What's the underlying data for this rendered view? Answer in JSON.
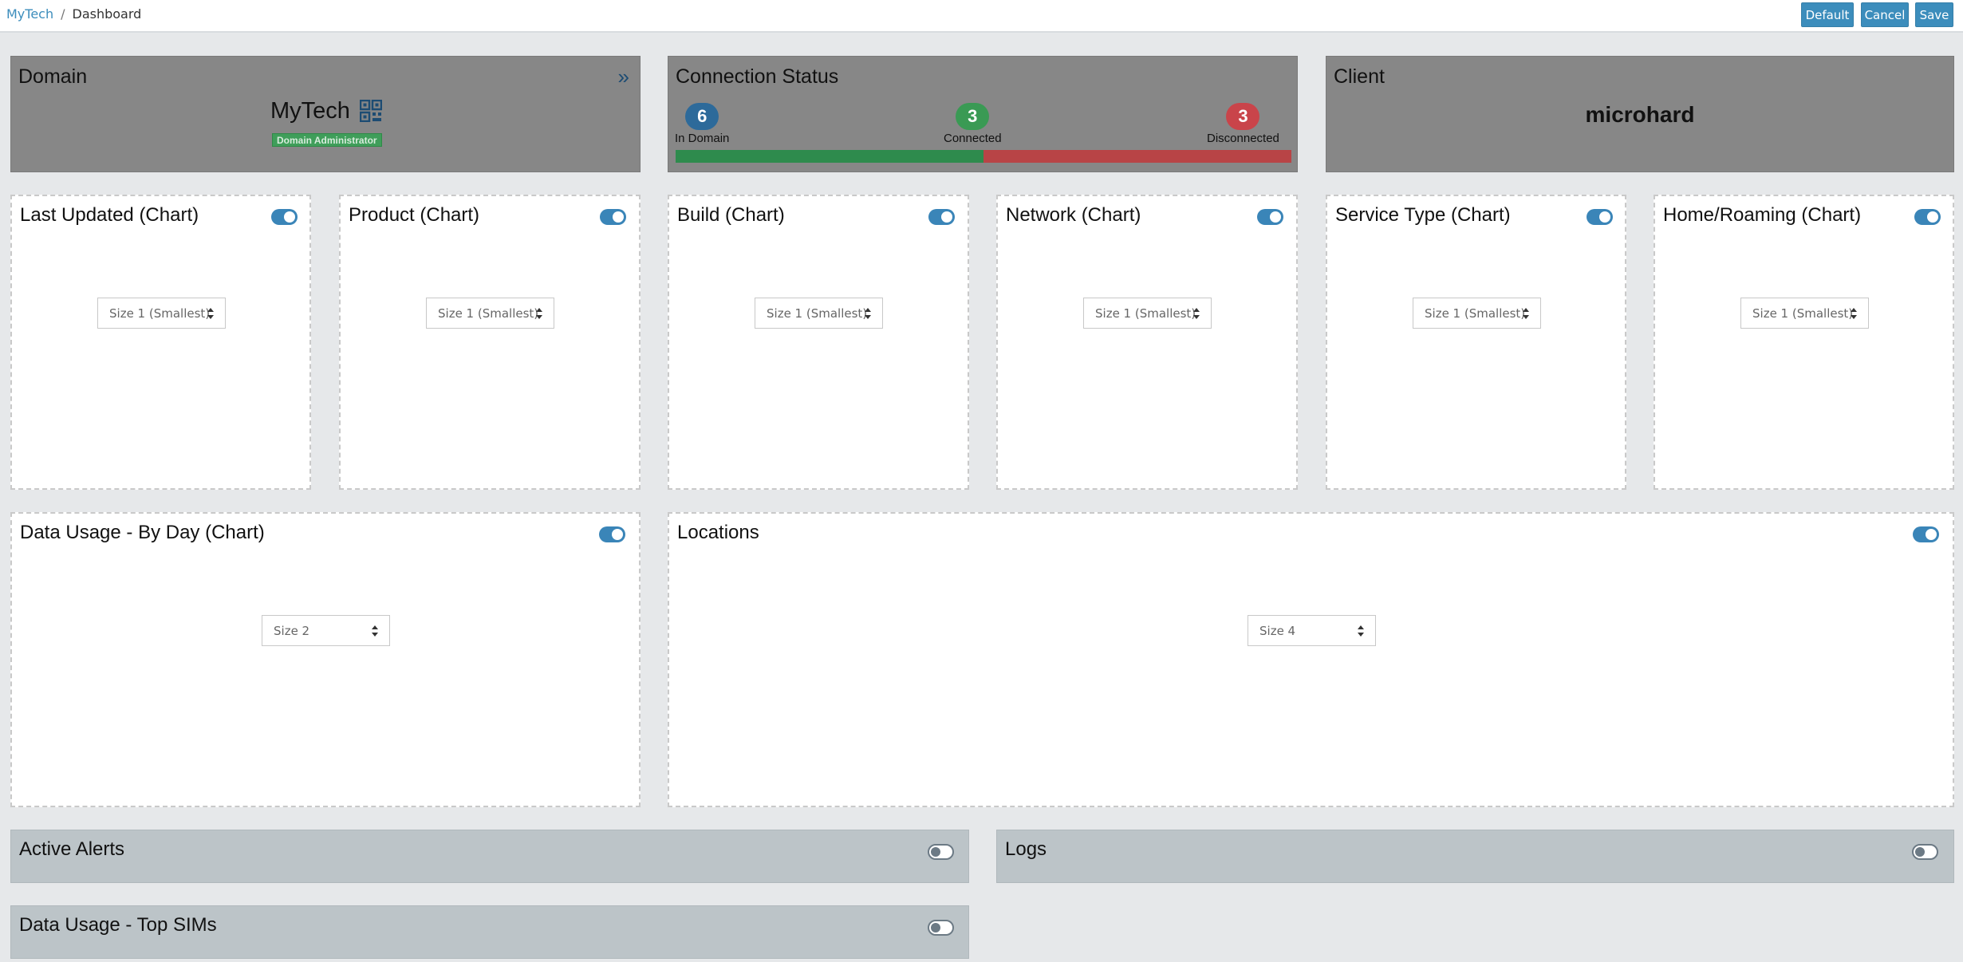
{
  "breadcrumb": {
    "home": "MyTech",
    "current": "Dashboard"
  },
  "toolbar": {
    "default_label": "Default",
    "cancel_label": "Cancel",
    "save_label": "Save"
  },
  "domain": {
    "title": "Domain",
    "name": "MyTech",
    "role": "Domain Administrator",
    "expand_icon": "»"
  },
  "connection_status": {
    "title": "Connection Status",
    "in_domain": {
      "count": "6",
      "label": "In Domain"
    },
    "connected": {
      "count": "3",
      "label": "Connected"
    },
    "disconnected": {
      "count": "3",
      "label": "Disconnected"
    },
    "connected_fraction": 0.5
  },
  "client": {
    "title": "Client",
    "name": "microhard"
  },
  "charts": [
    {
      "title": "Last Updated (Chart)",
      "size": "Size 1 (Smallest)",
      "enabled": true
    },
    {
      "title": "Product (Chart)",
      "size": "Size 1 (Smallest)",
      "enabled": true
    },
    {
      "title": "Build (Chart)",
      "size": "Size 1 (Smallest)",
      "enabled": true
    },
    {
      "title": "Network (Chart)",
      "size": "Size 1 (Smallest)",
      "enabled": true
    },
    {
      "title": "Service Type (Chart)",
      "size": "Size 1 (Smallest)",
      "enabled": true
    },
    {
      "title": "Home/Roaming (Chart)",
      "size": "Size 1 (Smallest)",
      "enabled": true
    }
  ],
  "data_usage_by_day": {
    "title": "Data Usage - By Day (Chart)",
    "size": "Size 2",
    "enabled": true
  },
  "locations": {
    "title": "Locations",
    "size": "Size 4",
    "enabled": true
  },
  "active_alerts": {
    "title": "Active Alerts",
    "enabled": false
  },
  "logs": {
    "title": "Logs",
    "enabled": false
  },
  "data_usage_top_sims": {
    "title": "Data Usage - Top SIMs",
    "enabled": false
  },
  "colors": {
    "accent": "#3c8dbc",
    "in_domain": "#2d6a9a",
    "connected": "#3a9a54",
    "disconnected": "#c9444a",
    "bar_connected": "#2e8b4d",
    "bar_disconnected": "#b84446"
  }
}
